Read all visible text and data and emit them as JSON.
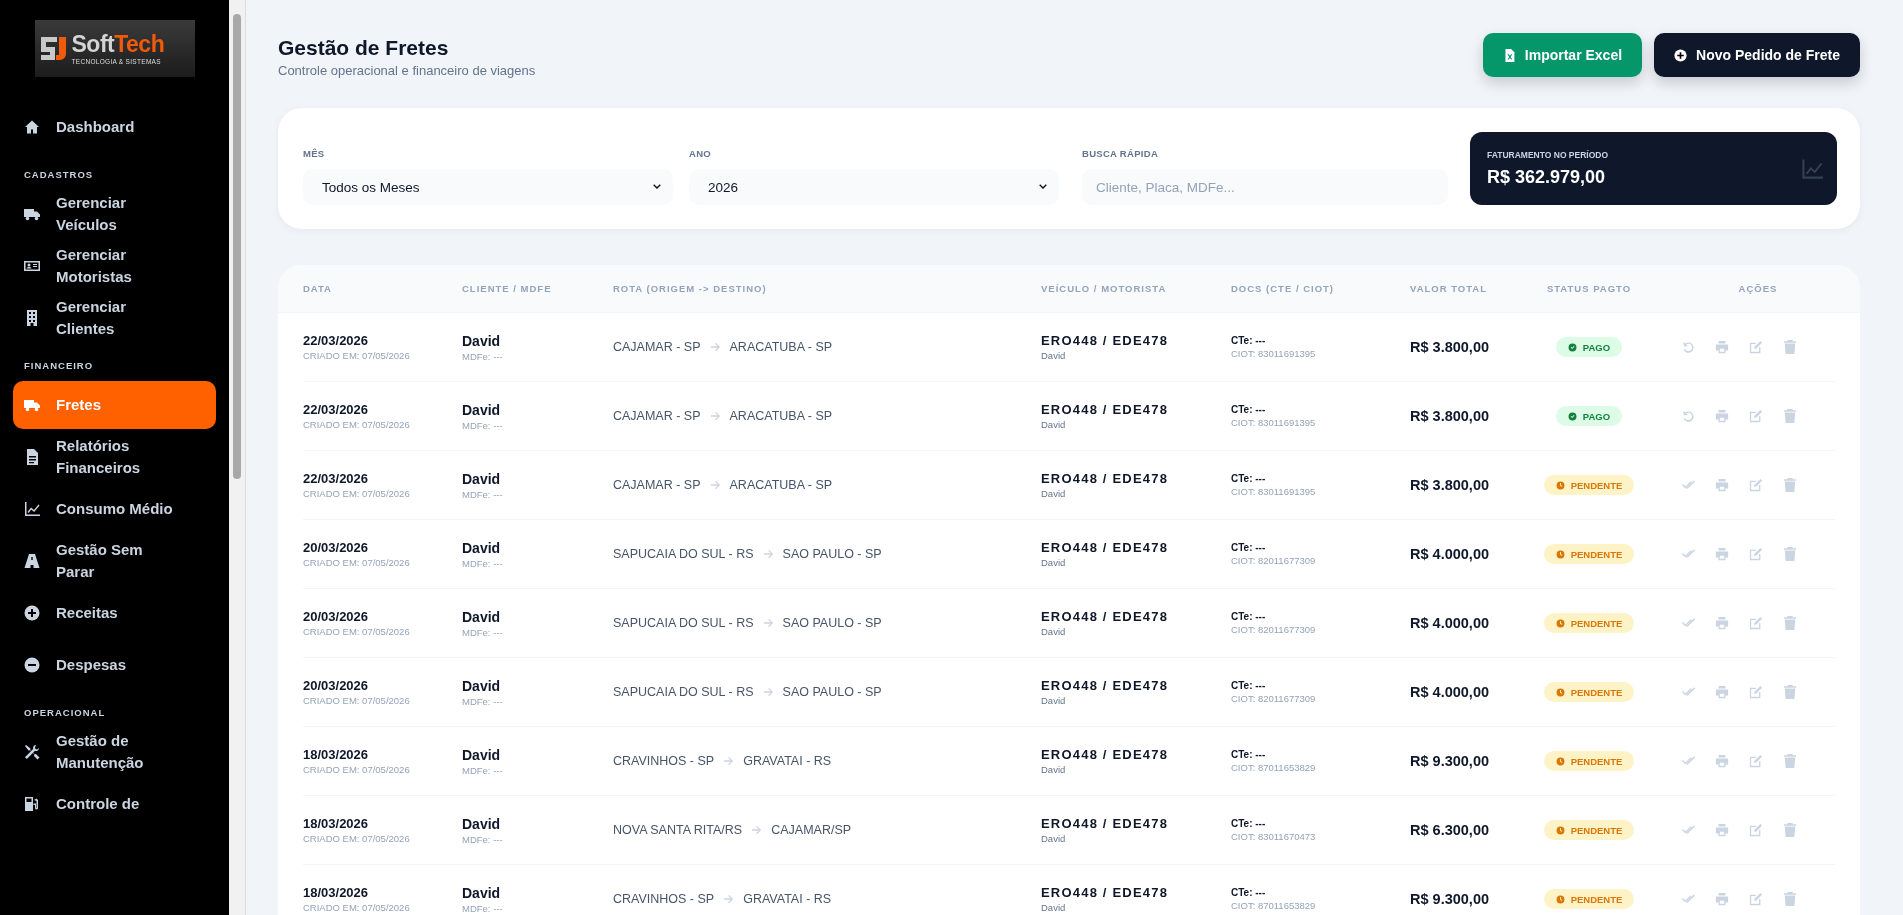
{
  "logo": {
    "name_part_1": "Soft",
    "name_part_2": "Tech",
    "tagline": "TECNOLOGIA & SISTEMAS"
  },
  "sidebar": {
    "groups": [
      {
        "items": [
          {
            "label": "Dashboard",
            "selected": false
          }
        ]
      },
      {
        "title": "CADASTROS",
        "items": [
          {
            "label": "Gerenciar Veículos",
            "selected": false
          },
          {
            "label": "Gerenciar Motoristas",
            "selected": false
          },
          {
            "label": "Gerenciar Clientes",
            "selected": false
          }
        ]
      },
      {
        "title": "FINANCEIRO",
        "items": [
          {
            "label": "Fretes",
            "selected": true
          },
          {
            "label": "Relatórios Financeiros",
            "selected": false
          },
          {
            "label": "Consumo Médio",
            "selected": false
          },
          {
            "label": "Gestão Sem Parar",
            "selected": false
          },
          {
            "label": "Receitas",
            "selected": false
          },
          {
            "label": "Despesas",
            "selected": false
          }
        ]
      },
      {
        "title": "OPERACIONAL",
        "items": [
          {
            "label": "Gestão de Manutenção",
            "selected": false
          },
          {
            "label": "Controle de",
            "selected": false
          }
        ]
      }
    ]
  },
  "header": {
    "title": "Gestão de Fretes",
    "subtitle": "Controle operacional e financeiro de viagens",
    "buttons": [
      {
        "label": "Importar Excel",
        "kind": "import"
      },
      {
        "label": "Novo Pedido de Frete",
        "kind": "new"
      }
    ]
  },
  "filters": {
    "month": {
      "label": "MÊS",
      "value": "Todos os Meses"
    },
    "year": {
      "label": "ANO",
      "value": "2026"
    },
    "search": {
      "label": "BUSCA RÁPIDA",
      "placeholder": "Cliente, Placa, MDFe..."
    },
    "revenue": {
      "label": "FATURAMENTO NO PERÍODO",
      "value": "R$ 362.979,00"
    }
  },
  "table": {
    "columns": [
      "DATA",
      "CLIENTE / MDFE",
      "ROTA (ORIGEM -> DESTINO)",
      "VEÍCULO / MOTORISTA",
      "DOCS (CTE / CIOT)",
      "VALOR TOTAL",
      "STATUS PAGTO",
      "AÇÕES"
    ],
    "rows": [
      {
        "date": "22/03/2026",
        "created": "CRIADO EM: 07/05/2026",
        "client": "David",
        "mdfe": "MDFe: ---",
        "origin": "CAJAMAR - SP",
        "destination": "ARACATUBA - SP",
        "vehicle": "ERO448 / EDE478",
        "driver": "David",
        "cte": "CTe: ---",
        "ciot": "CIOT: 83011691395",
        "value": "R$ 3.800,00",
        "status": {
          "kind": "paid",
          "label": "PAGO"
        }
      },
      {
        "date": "22/03/2026",
        "created": "CRIADO EM: 07/05/2026",
        "client": "David",
        "mdfe": "MDFe: ---",
        "origin": "CAJAMAR - SP",
        "destination": "ARACATUBA - SP",
        "vehicle": "ERO448 / EDE478",
        "driver": "David",
        "cte": "CTe: ---",
        "ciot": "CIOT: 83011691395",
        "value": "R$ 3.800,00",
        "status": {
          "kind": "paid",
          "label": "PAGO"
        }
      },
      {
        "date": "22/03/2026",
        "created": "CRIADO EM: 07/05/2026",
        "client": "David",
        "mdfe": "MDFe: ---",
        "origin": "CAJAMAR - SP",
        "destination": "ARACATUBA - SP",
        "vehicle": "ERO448 / EDE478",
        "driver": "David",
        "cte": "CTe: ---",
        "ciot": "CIOT: 83011691395",
        "value": "R$ 3.800,00",
        "status": {
          "kind": "pending",
          "label": "PENDENTE"
        }
      },
      {
        "date": "20/03/2026",
        "created": "CRIADO EM: 07/05/2026",
        "client": "David",
        "mdfe": "MDFe: ---",
        "origin": "SAPUCAIA DO SUL - RS",
        "destination": "SAO PAULO - SP",
        "vehicle": "ERO448 / EDE478",
        "driver": "David",
        "cte": "CTe: ---",
        "ciot": "CIOT: 82011677309",
        "value": "R$ 4.000,00",
        "status": {
          "kind": "pending",
          "label": "PENDENTE"
        }
      },
      {
        "date": "20/03/2026",
        "created": "CRIADO EM: 07/05/2026",
        "client": "David",
        "mdfe": "MDFe: ---",
        "origin": "SAPUCAIA DO SUL - RS",
        "destination": "SAO PAULO - SP",
        "vehicle": "ERO448 / EDE478",
        "driver": "David",
        "cte": "CTe: ---",
        "ciot": "CIOT: 82011677309",
        "value": "R$ 4.000,00",
        "status": {
          "kind": "pending",
          "label": "PENDENTE"
        }
      },
      {
        "date": "20/03/2026",
        "created": "CRIADO EM: 07/05/2026",
        "client": "David",
        "mdfe": "MDFe: ---",
        "origin": "SAPUCAIA DO SUL - RS",
        "destination": "SAO PAULO - SP",
        "vehicle": "ERO448 / EDE478",
        "driver": "David",
        "cte": "CTe: ---",
        "ciot": "CIOT: 82011677309",
        "value": "R$ 4.000,00",
        "status": {
          "kind": "pending",
          "label": "PENDENTE"
        }
      },
      {
        "date": "18/03/2026",
        "created": "CRIADO EM: 07/05/2026",
        "client": "David",
        "mdfe": "MDFe: ---",
        "origin": "CRAVINHOS - SP",
        "destination": "GRAVATAI - RS",
        "vehicle": "ERO448 / EDE478",
        "driver": "David",
        "cte": "CTe: ---",
        "ciot": "CIOT: 87011653829",
        "value": "R$ 9.300,00",
        "status": {
          "kind": "pending",
          "label": "PENDENTE"
        }
      },
      {
        "date": "18/03/2026",
        "created": "CRIADO EM: 07/05/2026",
        "client": "David",
        "mdfe": "MDFe: ---",
        "origin": "NOVA SANTA RITA/RS",
        "destination": "CAJAMAR/SP",
        "vehicle": "ERO448 / EDE478",
        "driver": "David",
        "cte": "CTe: ---",
        "ciot": "CIOT: 83011670473",
        "value": "R$ 6.300,00",
        "status": {
          "kind": "pending",
          "label": "PENDENTE"
        }
      },
      {
        "date": "18/03/2026",
        "created": "CRIADO EM: 07/05/2026",
        "client": "David",
        "mdfe": "MDFe: ---",
        "origin": "CRAVINHOS - SP",
        "destination": "GRAVATAI - RS",
        "vehicle": "ERO448 / EDE478",
        "driver": "David",
        "cte": "CTe: ---",
        "ciot": "CIOT: 87011653829",
        "value": "R$ 9.300,00",
        "status": {
          "kind": "pending",
          "label": "PENDENTE"
        }
      }
    ]
  }
}
